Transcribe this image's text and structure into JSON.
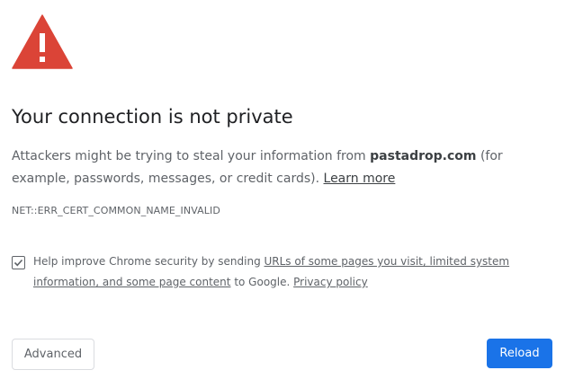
{
  "icon": "warning-triangle-icon",
  "colors": {
    "warning_red": "#db4437",
    "primary_blue": "#1a73e8",
    "text_gray": "#5f6368",
    "title_dark": "#202124"
  },
  "title": "Your connection is not private",
  "description": {
    "prefix": "Attackers might be trying to steal your information from ",
    "domain": "pastadrop.com",
    "suffix": " (for example, passwords, messages, or credit cards). ",
    "learn_more": "Learn more"
  },
  "error_code": "NET::ERR_CERT_COMMON_NAME_INVALID",
  "optin": {
    "checked": true,
    "text_before": "Help improve Chrome security by sending ",
    "link": "URLs of some pages you visit, limited system information, and some page content",
    "text_after": " to Google. ",
    "privacy_link": "Privacy policy"
  },
  "buttons": {
    "advanced": "Advanced",
    "reload": "Reload"
  }
}
